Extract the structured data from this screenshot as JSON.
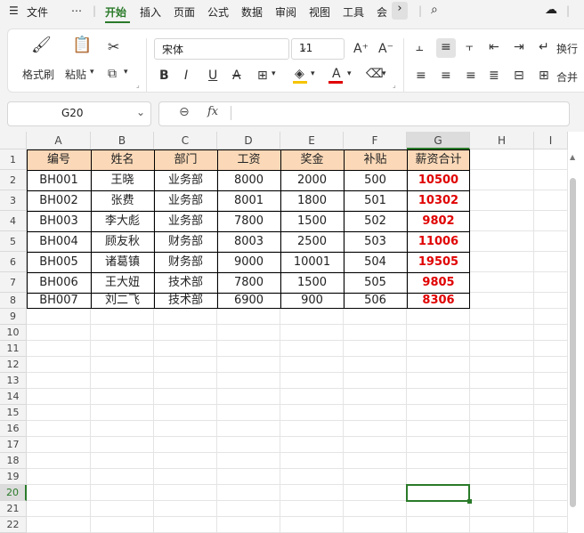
{
  "menu": {
    "file_label": "文件",
    "more_label": "⋯",
    "tabs": [
      "开始",
      "插入",
      "页面",
      "公式",
      "数据",
      "审阅",
      "视图",
      "工具",
      "会"
    ],
    "active_tab": "开始"
  },
  "ribbon": {
    "format_painter_label": "格式刷",
    "paste_label": "粘贴",
    "font_name": "宋体",
    "font_size": "11",
    "wrap_label": "换行",
    "merge_label": "合并"
  },
  "formula_bar": {
    "name_box": "G20",
    "fx_label": "fx",
    "formula_value": ""
  },
  "sheet": {
    "columns": [
      "A",
      "B",
      "C",
      "D",
      "E",
      "F",
      "G",
      "H",
      "I"
    ],
    "rows": [
      "1",
      "2",
      "3",
      "4",
      "5",
      "6",
      "7",
      "8",
      "9",
      "10",
      "11",
      "12",
      "13",
      "14",
      "15",
      "16",
      "17",
      "18",
      "19",
      "20",
      "21",
      "22"
    ],
    "table_headers": [
      "编号",
      "姓名",
      "部门",
      "工资",
      "奖金",
      "补贴",
      "薪资合计"
    ],
    "table_rows": [
      [
        "BH001",
        "王晓",
        "业务部",
        "8000",
        "2000",
        "500",
        "10500"
      ],
      [
        "BH002",
        "张费",
        "业务部",
        "8001",
        "1800",
        "501",
        "10302"
      ],
      [
        "BH003",
        "李大彪",
        "业务部",
        "7800",
        "1500",
        "502",
        "9802"
      ],
      [
        "BH004",
        "顾友秋",
        "财务部",
        "8003",
        "2500",
        "503",
        "11006"
      ],
      [
        "BH005",
        "诸葛镇",
        "财务部",
        "9000",
        "10001",
        "504",
        "19505"
      ],
      [
        "BH006",
        "王大妞",
        "技术部",
        "7800",
        "1500",
        "505",
        "9805"
      ],
      [
        "BH007",
        "刘二飞",
        "技术部",
        "6900",
        "900",
        "506",
        "8306"
      ]
    ],
    "selected_cell": "G20",
    "header_fill": "#fbd9b8",
    "total_color": "#e00000",
    "accent": "#2a7a2a"
  }
}
